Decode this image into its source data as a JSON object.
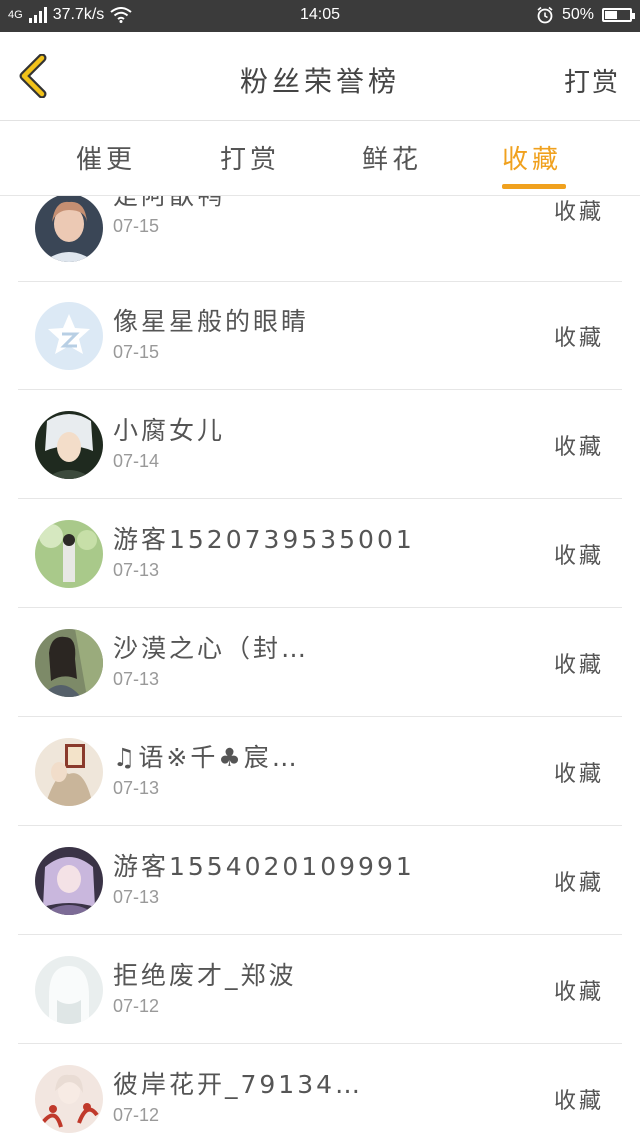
{
  "status_bar": {
    "network": "4G",
    "speed": "37.7k/s",
    "time": "14:05",
    "battery": "50%",
    "battery_level": 0.5
  },
  "header": {
    "title": "粉丝荣誉榜",
    "action": "打赏"
  },
  "tabs": [
    {
      "label": "催更",
      "active": false
    },
    {
      "label": "打赏",
      "active": false
    },
    {
      "label": "鲜花",
      "active": false
    },
    {
      "label": "收藏",
      "active": true
    }
  ],
  "accent_color": "#f0a11e",
  "rows": [
    {
      "name": "是阿歆鸭",
      "date": "07-15",
      "action": "收藏"
    },
    {
      "name": "像星星般的眼睛",
      "date": "07-15",
      "action": "收藏"
    },
    {
      "name": "小腐女儿",
      "date": "07-14",
      "action": "收藏"
    },
    {
      "name": "游客1520739535001",
      "date": "07-13",
      "action": "收藏"
    },
    {
      "name": "沙漠之心（封…",
      "date": "07-13",
      "action": "收藏"
    },
    {
      "name": "♫语※千♣宸…",
      "date": "07-13",
      "action": "收藏"
    },
    {
      "name": "游客1554020109991",
      "date": "07-13",
      "action": "收藏"
    },
    {
      "name": "拒绝废才_郑波",
      "date": "07-12",
      "action": "收藏"
    },
    {
      "name": "彼岸花开_79134…",
      "date": "07-12",
      "action": "收藏"
    }
  ]
}
